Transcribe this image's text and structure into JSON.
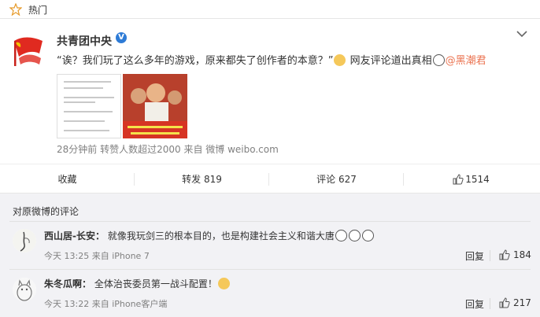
{
  "topbar": {
    "label": "热门",
    "icon": "star-icon"
  },
  "post": {
    "author": "共青团中央",
    "verified_badge": "V",
    "text_main": "“诶？我们玩了这么多年的游戏，原来都失了创作者的本意？”",
    "text_tail": "网友评论道出真相",
    "mention": "@黑潮君",
    "meta": "28分钟前 转赞人数超过2000 来自 微博 weibo.com",
    "actions": {
      "favorite": "收藏",
      "repost": "转发 819",
      "comment": "评论 627",
      "like": "1514"
    }
  },
  "comments": {
    "title": "对原微博的评论",
    "items": [
      {
        "name": "西山居-长安：",
        "text": "就像我玩剑三的根本目的，也是构建社会主义和谐大唐",
        "meta": "今天 13:25 来自 iPhone 7",
        "reply": "回复",
        "likes": "184"
      },
      {
        "name": "朱冬瓜啊：",
        "text": "全体治丧委员第一战斗配置！",
        "meta": "今天 13:22 来自 iPhone客户端",
        "reply": "回复",
        "likes": "217"
      }
    ]
  },
  "colors": {
    "mention": "#eb7350",
    "verified": "#2e7bd6",
    "meta": "#808080"
  }
}
